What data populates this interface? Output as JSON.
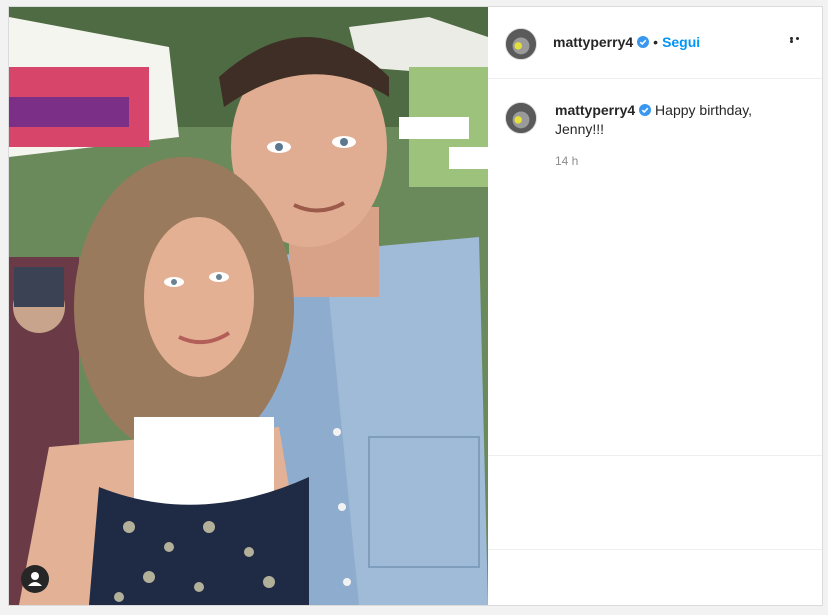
{
  "post": {
    "username": "mattyperry4",
    "separator": "•",
    "follow_label": "Segui",
    "caption": "Happy birthday, Jenny!!!",
    "timestamp": "14 h"
  },
  "icons": {
    "verified": "verified-badge-icon",
    "more": "more-options-icon",
    "user_tag": "user-tag-icon"
  },
  "colors": {
    "follow": "#0095f6",
    "verified": "#3897f0",
    "text": "#262626",
    "muted": "#8e8e8e",
    "border": "#dbdbdb"
  }
}
